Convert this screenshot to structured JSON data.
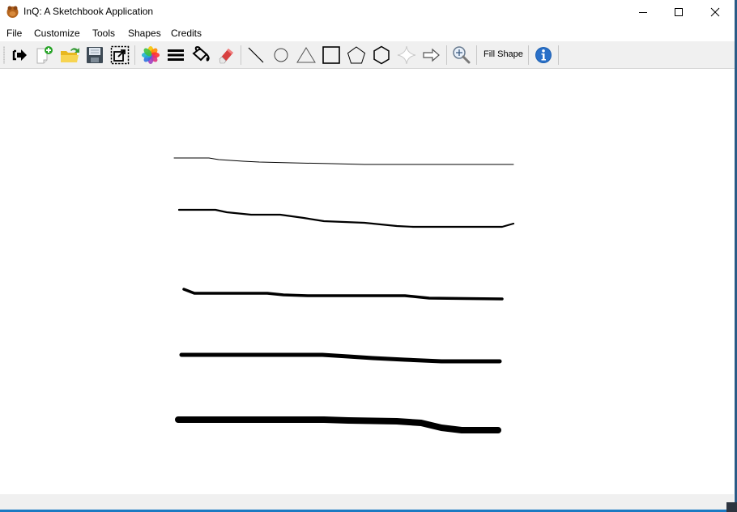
{
  "window": {
    "title": "InQ: A Sketchbook Application",
    "icon": "app-icon",
    "controls": [
      "minimize-icon",
      "maximize-icon",
      "close-icon"
    ]
  },
  "menu": {
    "items": [
      {
        "label": "File"
      },
      {
        "label": "Customize"
      },
      {
        "label": "Tools"
      },
      {
        "label": "Shapes"
      },
      {
        "label": "Credits"
      }
    ]
  },
  "toolbar": {
    "groups": [
      [
        "exit-icon",
        "new-file-icon",
        "open-folder-icon",
        "save-icon",
        "resize-canvas-icon"
      ],
      [
        "color-palette-icon",
        "pen-width-icon",
        "fill-bucket-icon",
        "eraser-icon"
      ],
      [
        "line-icon",
        "circle-icon",
        "triangle-icon",
        "rectangle-icon",
        "pentagon-icon",
        "hexagon-icon",
        "star-icon",
        "arrow-icon"
      ],
      [
        "zoom-icon"
      ],
      [
        "fill-shape"
      ],
      [
        "info-icon"
      ]
    ],
    "fill_shape_label": "Fill Shape"
  },
  "canvas": {
    "strokes": [
      {
        "name": "stroke-thin",
        "width_level": 1
      },
      {
        "name": "stroke-medium",
        "width_level": 2
      },
      {
        "name": "stroke-thick",
        "width_level": 3
      },
      {
        "name": "stroke-heavier",
        "width_level": 4
      },
      {
        "name": "stroke-heaviest",
        "width_level": 5
      }
    ],
    "stroke_color": "#000000"
  }
}
